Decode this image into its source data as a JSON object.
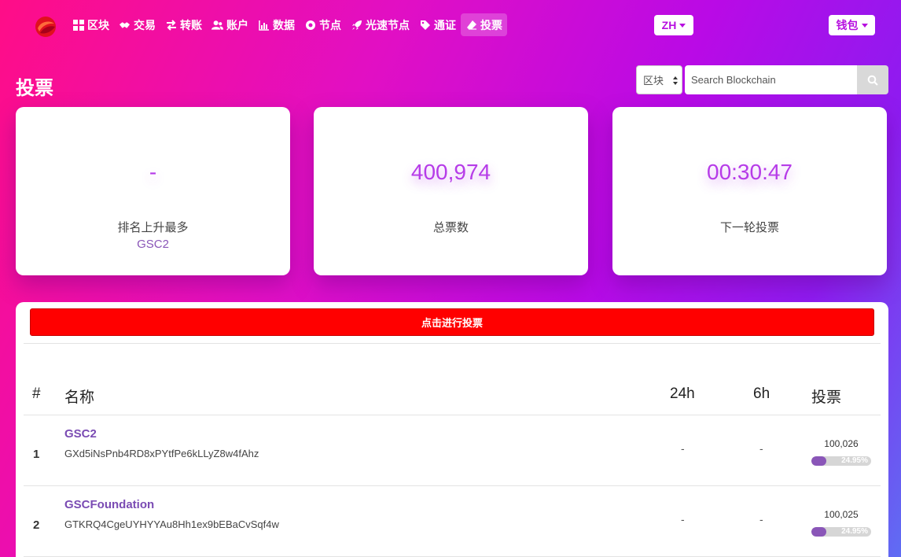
{
  "nav": {
    "items": [
      {
        "label": "区块",
        "icon": "grid-icon"
      },
      {
        "label": "交易",
        "icon": "handshake-icon"
      },
      {
        "label": "转账",
        "icon": "exchange-arrows-icon"
      },
      {
        "label": "账户",
        "icon": "users-icon"
      },
      {
        "label": "数据",
        "icon": "bar-chart-icon"
      },
      {
        "label": "节点",
        "icon": "dot-circle-icon"
      },
      {
        "label": "光速节点",
        "icon": "rocket-icon"
      },
      {
        "label": "通证",
        "icon": "tag-icon"
      },
      {
        "label": "投票",
        "icon": "eraser-icon"
      }
    ],
    "active": "投票",
    "lang": "ZH",
    "wallet": "钱包"
  },
  "page": {
    "title": "投票"
  },
  "search": {
    "type": "区块",
    "placeholder": "Search Blockchain"
  },
  "stats": [
    {
      "value": "-",
      "label": "排名上升最多",
      "sub": "GSC2"
    },
    {
      "value": "400,974",
      "label": "总票数"
    },
    {
      "value": "00:30:47",
      "label": "下一轮投票"
    }
  ],
  "vote_button": "点击进行投票",
  "table": {
    "headers": {
      "rank": "#",
      "name": "名称",
      "h24": "24h",
      "h6": "6h",
      "votes": "投票"
    },
    "rows": [
      {
        "rank": "1",
        "name": "GSC2",
        "address": "GXd5iNsPnb4RD8xPYtfPe6kLLyZ8w4fAhz",
        "h24": "-",
        "h6": "-",
        "votes": "100,026",
        "percent": "24.95%",
        "fraction": 0.2495
      },
      {
        "rank": "2",
        "name": "GSCFoundation",
        "address": "GTKRQ4CgeUYHYYAu8Hh1ex9bEBaCvSqf4w",
        "h24": "-",
        "h6": "-",
        "votes": "100,025",
        "percent": "24.95%",
        "fraction": 0.2495
      }
    ]
  },
  "colors": {
    "accent": "#b63be8",
    "vote_button": "#ff0000",
    "bar_fill": "#8a56b8"
  }
}
